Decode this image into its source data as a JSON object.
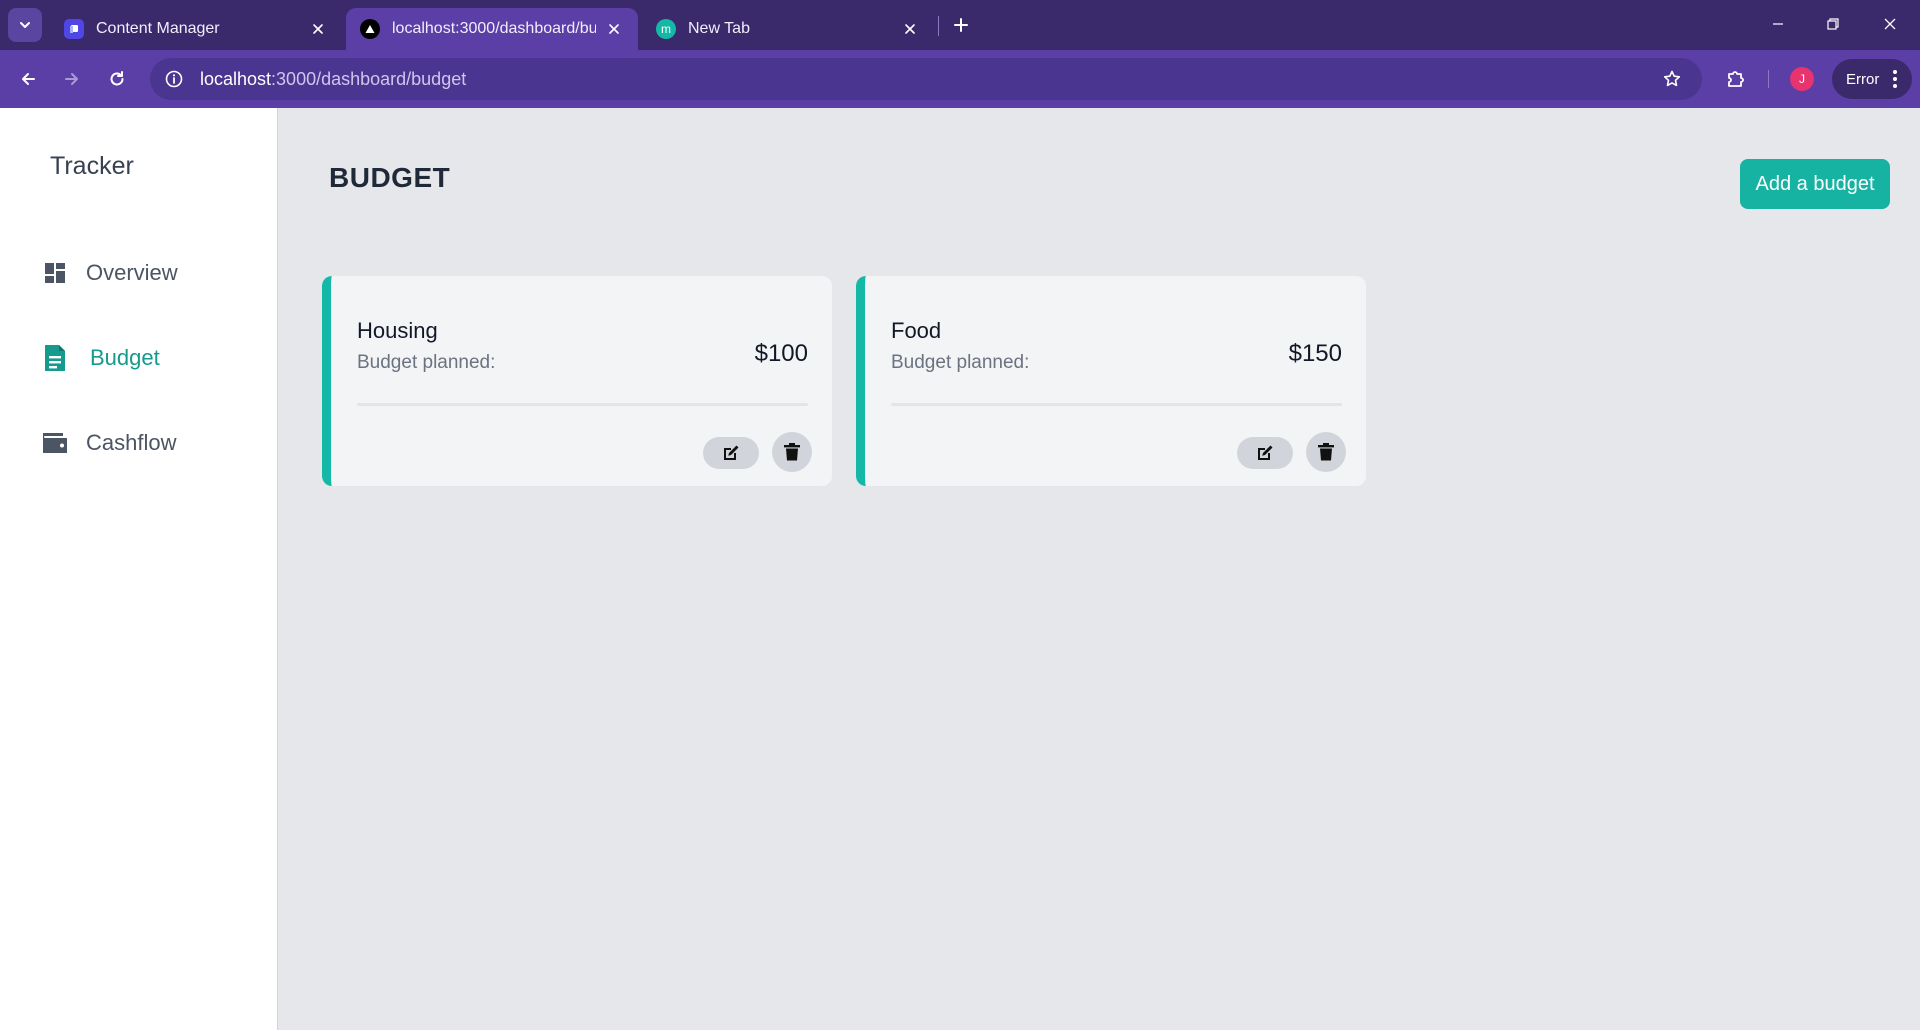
{
  "browser": {
    "tabs": [
      {
        "title": "Content Manager",
        "active": false,
        "favicon": "content-manager-icon"
      },
      {
        "title": "localhost:3000/dashboard/budget",
        "active": true,
        "favicon": "vercel-triangle-icon"
      },
      {
        "title": "New Tab",
        "active": false,
        "favicon": "m-circle-icon"
      }
    ],
    "url_host": "localhost",
    "url_rest": ":3000/dashboard/budget",
    "profile_initial": "J",
    "error_label": "Error",
    "colors": {
      "frame": "#3a2a6b",
      "toolbar": "#5b3fa6",
      "omnibox": "#4a3590",
      "avatar": "#e8336e"
    }
  },
  "sidebar": {
    "brand": "Tracker",
    "items": [
      {
        "label": "Overview",
        "icon": "dashboard-grid-icon",
        "active": false
      },
      {
        "label": "Budget",
        "icon": "document-icon",
        "active": true
      },
      {
        "label": "Cashflow",
        "icon": "wallet-icon",
        "active": false
      }
    ]
  },
  "main": {
    "title": "BUDGET",
    "add_button": "Add a budget",
    "cards": [
      {
        "name": "Housing",
        "subtitle": "Budget planned:",
        "amount": "$100"
      },
      {
        "name": "Food",
        "subtitle": "Budget planned:",
        "amount": "$150"
      }
    ]
  },
  "colors": {
    "accent": "#14b8a6",
    "active_nav": "#159a8e",
    "background": "#e5e7eb",
    "card": "#f3f4f6"
  }
}
